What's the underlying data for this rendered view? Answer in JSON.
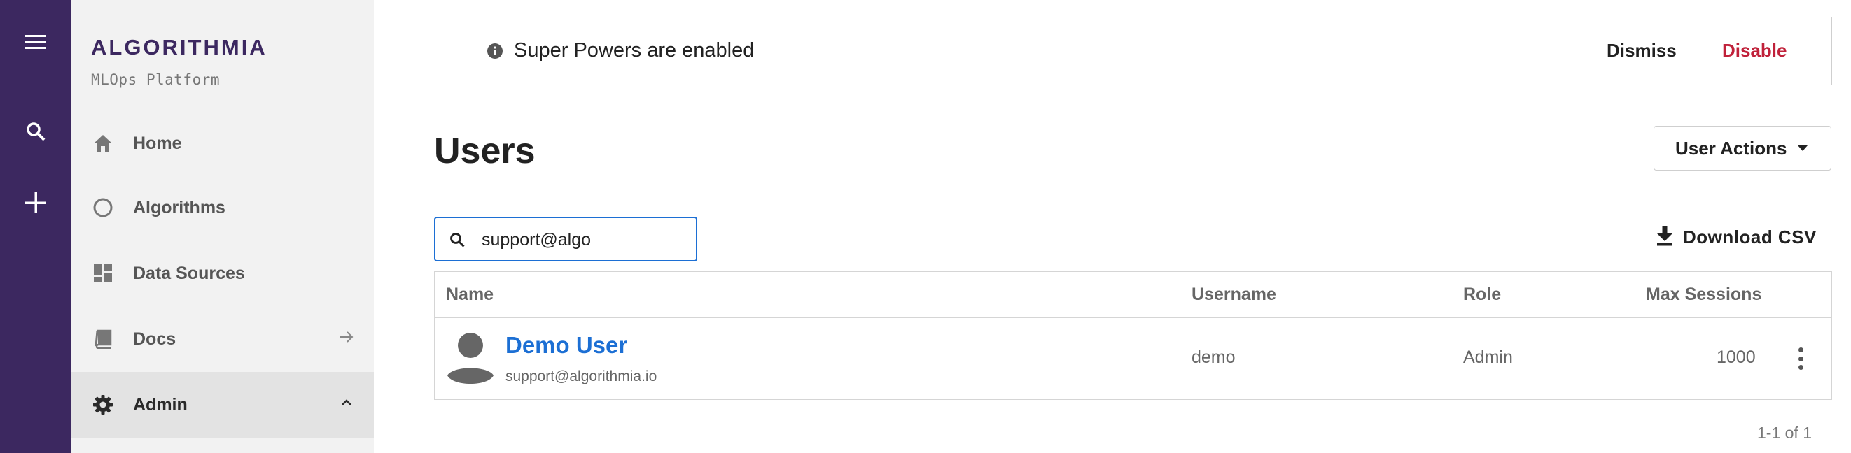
{
  "rail": {
    "items": [
      {
        "name": "menu-icon"
      },
      {
        "name": "search-icon"
      },
      {
        "name": "plus-icon"
      }
    ],
    "bg_color": "#3c2860"
  },
  "nav": {
    "brand": "ALGORITHMIA",
    "subtitle": "MLOps Platform",
    "items": [
      {
        "label": "Home",
        "icon": "home-icon"
      },
      {
        "label": "Algorithms",
        "icon": "circle-icon"
      },
      {
        "label": "Data Sources",
        "icon": "dashboard-icon"
      },
      {
        "label": "Docs",
        "icon": "book-icon",
        "trailing_icon": "arrow-right-icon"
      },
      {
        "label": "Admin",
        "icon": "gear-icon",
        "trailing_icon": "chevron-up-icon",
        "active": true
      }
    ]
  },
  "banner": {
    "text": "Super Powers are enabled",
    "icon": "info-icon",
    "dismiss_label": "Dismiss",
    "disable_label": "Disable",
    "disable_color": "#c0213a"
  },
  "page": {
    "title": "Users",
    "actions_label": "User Actions"
  },
  "search": {
    "value": "support@algo",
    "icon": "search-icon"
  },
  "download": {
    "label": "Download CSV",
    "icon": "download-icon"
  },
  "table": {
    "columns": [
      "Name",
      "Username",
      "Role",
      "Max Sessions"
    ],
    "rows": [
      {
        "name": "Demo User",
        "email": "support@algorithmia.io",
        "username": "demo",
        "role": "Admin",
        "max_sessions": "1000"
      }
    ]
  },
  "pagination": {
    "text": "1-1 of 1"
  },
  "accent_color": "#1c6fd4"
}
